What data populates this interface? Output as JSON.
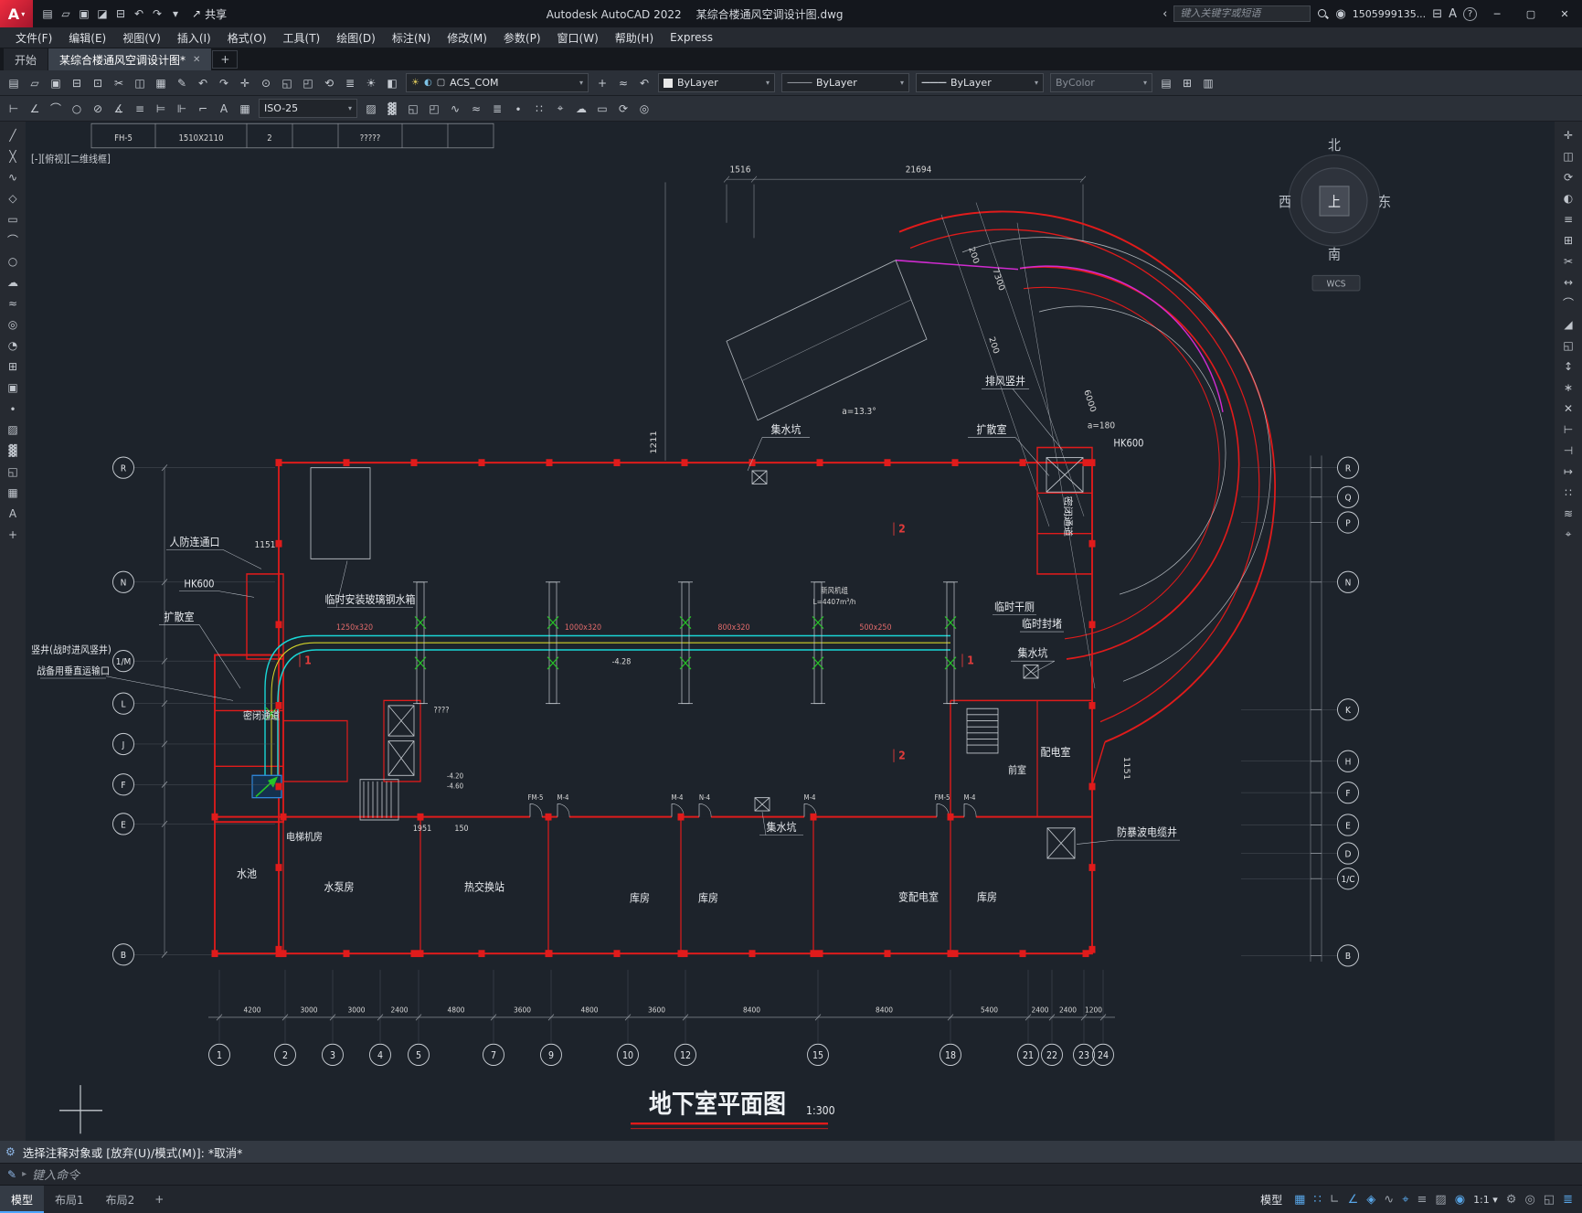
{
  "colors": {
    "wall_red": "#e01b1b",
    "duct_cyan": "#1ad6d6",
    "duct_yellow": "#d3d32a",
    "fitting_green": "#27c427",
    "ramp_magenta": "#d02bd0",
    "line_white": "#c9ced4",
    "canvas_bg": "#1d232b",
    "chrome_bg": "#2b3038",
    "accent_blue": "#4da6ff"
  },
  "titlebar": {
    "logo": "A",
    "app_title": "Autodesk AutoCAD 2022",
    "doc_title": "某综合楼通风空调设计图.dwg",
    "share_label": "共享",
    "search_placeholder": "键入关键字或短语",
    "user_id": "1505999135...",
    "help_label": "?"
  },
  "menubar": {
    "items": [
      "文件(F)",
      "编辑(E)",
      "视图(V)",
      "插入(I)",
      "格式(O)",
      "工具(T)",
      "绘图(D)",
      "标注(N)",
      "修改(M)",
      "参数(P)",
      "窗口(W)",
      "帮助(H)",
      "Express"
    ]
  },
  "tabbar": {
    "start_tab": "开始",
    "doc_tab": "某综合楼通风空调设计图*",
    "new_tab": "+"
  },
  "toolbars": {
    "layer_name": "ACS_COM",
    "color": "ByLayer",
    "linetype": "ByLayer",
    "lineweight": "ByLayer",
    "plotstyle": "ByColor",
    "dimstyle": "ISO-25"
  },
  "icons": {
    "qat": [
      [
        "new",
        "▤"
      ],
      [
        "open",
        "▱"
      ],
      [
        "save",
        "▣"
      ],
      [
        "save-as",
        "◪"
      ],
      [
        "plot",
        "⊟"
      ],
      [
        "undo",
        "↶"
      ],
      [
        "redo",
        "↷"
      ],
      [
        "workspace-dropdown",
        "▾"
      ]
    ],
    "tb1_left": [
      [
        "new",
        "▤"
      ],
      [
        "open",
        "▱"
      ],
      [
        "save",
        "▣"
      ],
      [
        "plot",
        "⊟"
      ],
      [
        "plot-preview",
        "⊡"
      ],
      [
        "cut",
        "✂"
      ],
      [
        "copy",
        "◫"
      ],
      [
        "paste",
        "▦"
      ],
      [
        "match-properties",
        "✎"
      ],
      [
        "undo",
        "↶"
      ],
      [
        "redo",
        "↷"
      ],
      [
        "pan",
        "✛"
      ],
      [
        "zoom-realtime",
        "⊙"
      ],
      [
        "zoom-window",
        "◱"
      ],
      [
        "zoom-previous",
        "◰"
      ],
      [
        "regen",
        "⟲"
      ]
    ],
    "tb1_layer": [
      [
        "layer-properties",
        "≣"
      ],
      [
        "layer-off",
        "☀"
      ],
      [
        "layer-isolate",
        "◧"
      ]
    ],
    "tb1_mid": [
      [
        "make-object-layer-current",
        "+"
      ],
      [
        "layer-match",
        "≈"
      ],
      [
        "layer-previous",
        "↶"
      ]
    ],
    "tb1_right": [
      [
        "properties-palette",
        "▤"
      ],
      [
        "design-center",
        "⊞"
      ],
      [
        "tool-palettes",
        "▥"
      ]
    ],
    "tb2_left": [
      [
        "dim-linear",
        "⊢"
      ],
      [
        "dim-aligned",
        "∠"
      ],
      [
        "dim-arc",
        "⌒"
      ],
      [
        "dim-radius",
        "○"
      ],
      [
        "dim-diameter",
        "⊘"
      ],
      [
        "dim-angular",
        "∡"
      ],
      [
        "quick-dim",
        "≡"
      ],
      [
        "dim-baseline",
        "⊨"
      ],
      [
        "dim-continue",
        "⊩"
      ],
      [
        "multileader",
        "⌐"
      ],
      [
        "text",
        "A"
      ],
      [
        "table",
        "▦"
      ]
    ],
    "tb2_right": [
      [
        "hatch",
        "▨"
      ],
      [
        "gradient",
        "▓"
      ],
      [
        "boundary",
        "◱"
      ],
      [
        "region",
        "◰"
      ],
      [
        "polyline-edit",
        "∿"
      ],
      [
        "spline-edit",
        "≈"
      ],
      [
        "multiline",
        "≣"
      ],
      [
        "point",
        "∙"
      ],
      [
        "divide",
        "∷"
      ],
      [
        "measure",
        "⌖"
      ],
      [
        "revision-cloud",
        "☁"
      ],
      [
        "wipeout",
        "▭"
      ],
      [
        "orbit",
        "⟳"
      ],
      [
        "named-views",
        "◎"
      ]
    ],
    "left_palette": [
      [
        "line",
        "╱"
      ],
      [
        "construction-line",
        "╳"
      ],
      [
        "polyline",
        "∿"
      ],
      [
        "polygon",
        "◇"
      ],
      [
        "rectangle",
        "▭"
      ],
      [
        "arc",
        "⌒"
      ],
      [
        "circle",
        "○"
      ],
      [
        "revision-cloud",
        "☁"
      ],
      [
        "spline",
        "≈"
      ],
      [
        "ellipse",
        "◎"
      ],
      [
        "ellipse-arc",
        "◔"
      ],
      [
        "insert-block",
        "⊞"
      ],
      [
        "create-block",
        "▣"
      ],
      [
        "point",
        "∙"
      ],
      [
        "hatch",
        "▨"
      ],
      [
        "gradient",
        "▓"
      ],
      [
        "region",
        "◱"
      ],
      [
        "table",
        "▦"
      ],
      [
        "multiline-text",
        "A"
      ],
      [
        "add-selected",
        "+"
      ]
    ],
    "right_palette": [
      [
        "move",
        "✛"
      ],
      [
        "copy",
        "◫"
      ],
      [
        "rotate",
        "⟳"
      ],
      [
        "mirror",
        "◐"
      ],
      [
        "offset",
        "≡"
      ],
      [
        "array",
        "⊞"
      ],
      [
        "trim",
        "✂"
      ],
      [
        "extend",
        "↔"
      ],
      [
        "fillet",
        "⌒"
      ],
      [
        "chamfer",
        "◢"
      ],
      [
        "scale",
        "◱"
      ],
      [
        "stretch",
        "↕"
      ],
      [
        "explode",
        "∗"
      ],
      [
        "erase",
        "✕"
      ],
      [
        "join",
        "⊢"
      ],
      [
        "break",
        "⊣"
      ],
      [
        "lengthen",
        "↦"
      ],
      [
        "divide",
        "∷"
      ],
      [
        "align",
        "≋"
      ],
      [
        "measure",
        "⌖"
      ]
    ]
  },
  "canvas": {
    "viewport_label": "[-][俯视][二维线框]",
    "table_cells": [
      "FH-5",
      "1510X2110",
      "2",
      "?????"
    ],
    "compass": {
      "north": "北",
      "south": "南",
      "east": "东",
      "west": "西",
      "top": "上"
    },
    "wcs_label": "WCS",
    "labels": {
      "paifeng": "排风竖井",
      "jishui1": "集水坑",
      "jishui2": "集水坑",
      "jishui3": "集水坑",
      "kuosan1": "扩散室",
      "kuosan2": "扩散室",
      "renfang": "人防连通口",
      "shuixiang": "临时安装玻璃钢水箱",
      "gance": "临时干厕",
      "fengdu": "临时封堵",
      "mibi1": "密闭通道",
      "mibi2": "密闭通道",
      "peidian": "配电室",
      "qianshi": "前室",
      "dianti": "电梯机房",
      "shuichi": "水池",
      "shuibeng": "水泵房",
      "rejiaohuan": "热交换站",
      "kufang1": "库房",
      "kufang2": "库房",
      "kufang3": "库房",
      "bianpeidian": "变配电室",
      "fangbaobo": "防暴波电缆井",
      "shujing1": "竖井(战时进风竖井)",
      "shujing2": "战备用垂直运输口",
      "hk600a": "HK600",
      "hk600b": "HK600",
      "angle1": "a=13.3°",
      "angle2": "a=180"
    },
    "dims": {
      "d1516": "1516",
      "d21694": "21694",
      "d7300": "7300",
      "d200a": "200",
      "d200b": "200",
      "d6000": "6000",
      "d1211": "1211",
      "d1151a": "1151",
      "d1151b": "1151",
      "d1951": "1951",
      "d150": "150",
      "lvl1": "-4.28",
      "lvl2": "-4.20",
      "lvl3": "-4.60",
      "q1": "????"
    },
    "duct_sizes": [
      "1250x320",
      "1000x320",
      "800x320",
      "500x250"
    ],
    "ahu": [
      "新风机组",
      "L=4407m³/h"
    ],
    "doors": [
      "FM-5",
      "M-4",
      "M-4",
      "N-4",
      "M-4",
      "FM-5",
      "M-4"
    ],
    "markers": [
      "2",
      "1",
      "1",
      "2"
    ],
    "grid_bottom": [
      "1",
      "2",
      "3",
      "4",
      "5",
      "7",
      "9",
      "10",
      "12",
      "15",
      "18",
      "21",
      "22",
      "23",
      "24"
    ],
    "grid_left": [
      "R",
      "N",
      "1/M",
      "L",
      "J",
      "F",
      "E",
      "B"
    ],
    "grid_right": [
      "R",
      "Q",
      "P",
      "N",
      "K",
      "H",
      "F",
      "E",
      "D",
      "1/C",
      "B"
    ],
    "dims_bottom": [
      "4200",
      "3000",
      "3000",
      "2400",
      "4800",
      "3600",
      "4800",
      "3600",
      "8400",
      "8400",
      "5400",
      "2400",
      "2400",
      "1200"
    ],
    "title": "地下室平面图",
    "title_scale": "1:300"
  },
  "commandline": {
    "history": "选择注释对象或 [放弃(U)/模式(M)]: *取消*",
    "prompt": "键入命令"
  },
  "statusbar": {
    "tabs": [
      "模型",
      "布局1",
      "布局2"
    ],
    "new_layout": "+",
    "model_toggle": "模型",
    "scale_label": "1:1",
    "right_icons": [
      [
        "grid",
        "▦",
        true
      ],
      [
        "snap",
        "∷",
        true
      ],
      [
        "ortho",
        "∟",
        false
      ],
      [
        "polar",
        "∠",
        true
      ],
      [
        "osnap",
        "◈",
        true
      ],
      [
        "otrack",
        "∿",
        false
      ],
      [
        "dynamic-input",
        "⌖",
        true
      ],
      [
        "lineweight",
        "≡",
        false
      ],
      [
        "transparency",
        "▨",
        false
      ],
      [
        "selection-cycling",
        "◉",
        true
      ],
      [
        "scale"
      ],
      [
        "workspace",
        "⚙",
        false
      ],
      [
        "isolate",
        "◎",
        false
      ],
      [
        "clean-screen",
        "◱",
        false
      ],
      [
        "customize",
        "≣",
        true
      ]
    ]
  }
}
